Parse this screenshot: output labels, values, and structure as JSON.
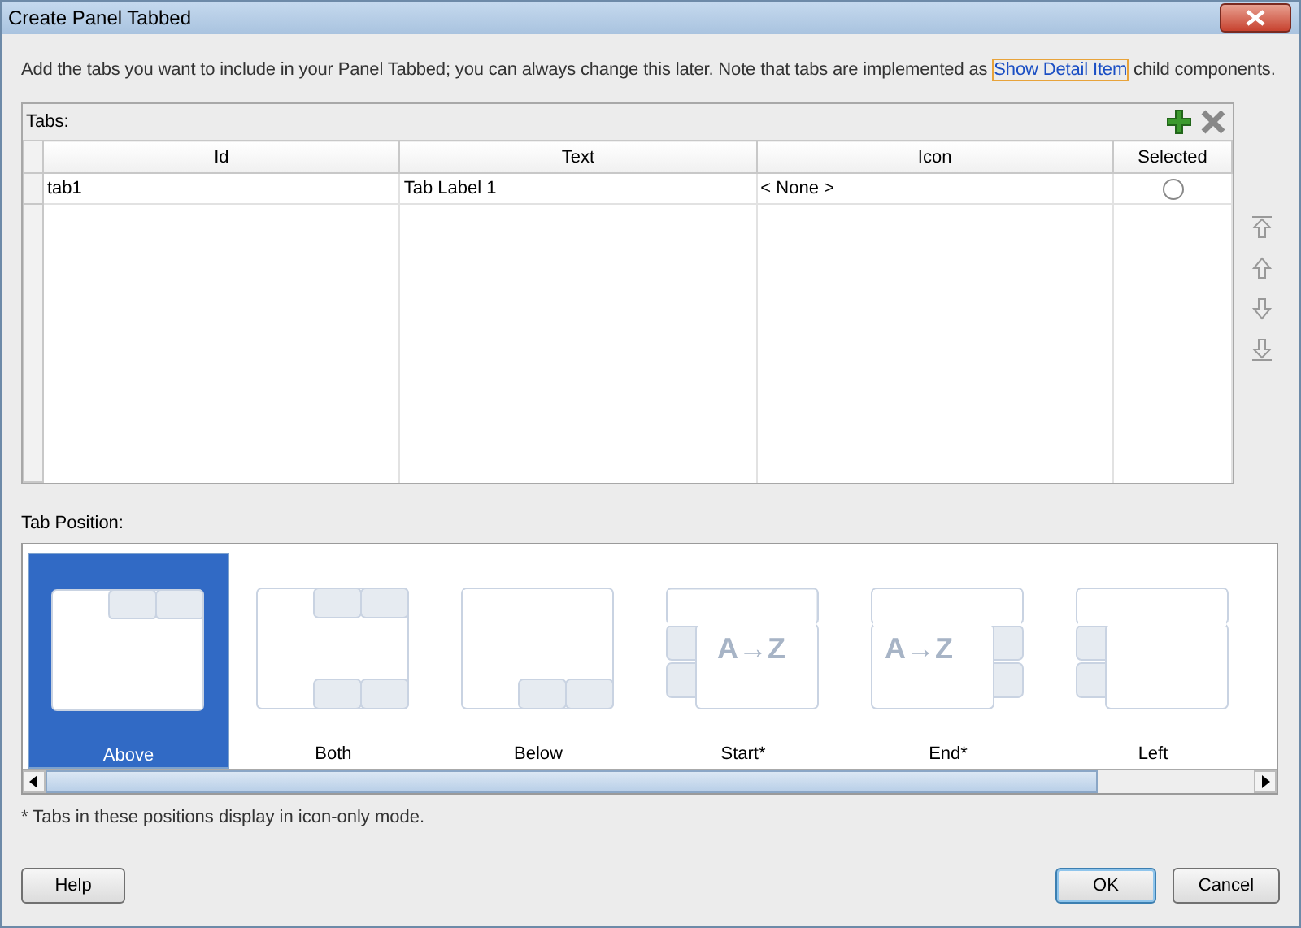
{
  "window": {
    "title": "Create Panel Tabbed"
  },
  "intro": {
    "text": "Add the tabs you want to include in your Panel Tabbed; you can always change this later. Note that tabs are implemented as",
    "link": "Show Detail Item",
    "after": "child components."
  },
  "tabs_panel": {
    "label": "Tabs:",
    "columns": [
      "Id",
      "Text",
      "Icon",
      "Selected"
    ],
    "rows": [
      {
        "id": "tab1",
        "text": "Tab Label 1",
        "icon": "< None >",
        "selected": false
      }
    ]
  },
  "tab_position": {
    "label": "Tab Position:",
    "options": [
      {
        "label": "Above",
        "kind": "above",
        "selected": true
      },
      {
        "label": "Both",
        "kind": "both",
        "selected": false
      },
      {
        "label": "Below",
        "kind": "below",
        "selected": false
      },
      {
        "label": "Start*",
        "kind": "start",
        "selected": false,
        "preview": "A→Z"
      },
      {
        "label": "End*",
        "kind": "end",
        "selected": false,
        "preview": "A→Z"
      },
      {
        "label": "Left",
        "kind": "left",
        "selected": false
      }
    ]
  },
  "footnote": "* Tabs in these positions display in icon-only mode.",
  "buttons": {
    "help": "Help",
    "ok": "OK",
    "cancel": "Cancel"
  }
}
